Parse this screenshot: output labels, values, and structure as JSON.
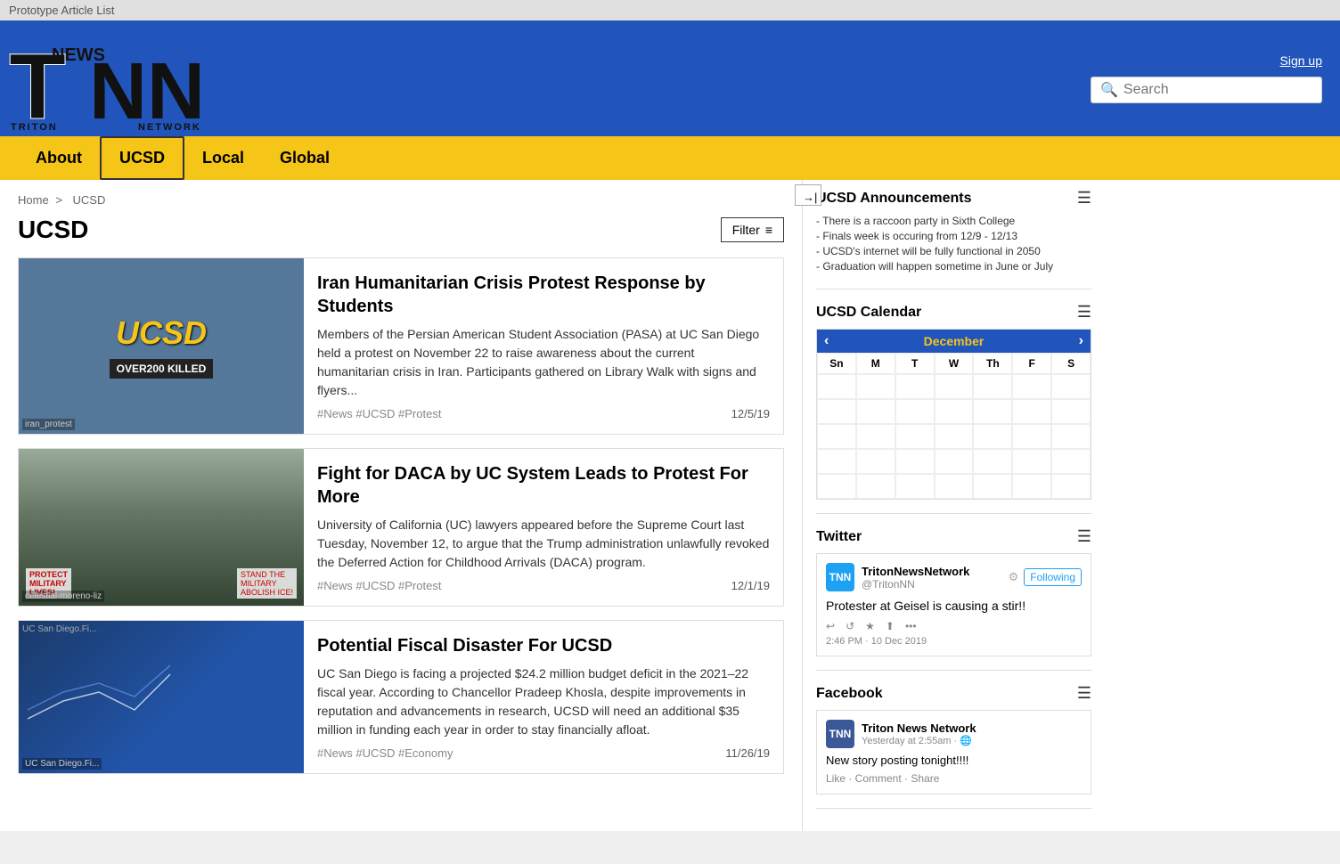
{
  "titleBar": {
    "text": "Prototype Article List"
  },
  "header": {
    "logoText": "TNN",
    "logoTriton": "TRITON",
    "logoNews": "NEWS",
    "logoNetwork": "NETWORK",
    "signupLabel": "Sign up",
    "searchPlaceholder": "Search"
  },
  "nav": {
    "items": [
      {
        "id": "about",
        "label": "About",
        "active": false
      },
      {
        "id": "ucsd",
        "label": "UCSD",
        "active": true
      },
      {
        "id": "local",
        "label": "Local",
        "active": false
      },
      {
        "id": "global",
        "label": "Global",
        "active": false
      }
    ]
  },
  "breadcrumb": {
    "home": "Home",
    "separator": ">",
    "current": "UCSD"
  },
  "pageTitle": "UCSD",
  "filterLabel": "Filter",
  "articles": [
    {
      "id": "article-1",
      "title": "Iran Humanitarian Crisis Protest Response by Students",
      "excerpt": "Members of the Persian American Student Association (PASA) at UC San Diego held a protest on November 22 to raise awareness about the current humanitarian crisis in Iran. Participants gathered on Library Walk with signs and flyers...",
      "tags": "#News #UCSD #Protest",
      "date": "12/5/19",
      "imageLabel": "iran_protest",
      "imageType": "ucsd-protest"
    },
    {
      "id": "article-2",
      "title": "Fight for DACA by UC System Leads to Protest For More",
      "excerpt": "University of California (UC) lawyers appeared before the Supreme Court last Tuesday, November 12, to argue that the Trump administration unlawfully revoked the Deferred Action for Childhood Arrivals (DACA) program.",
      "tags": "#News #UCSD #Protest",
      "date": "12/1/19",
      "imageLabel": "celestial-moreno-liz",
      "imageType": "daca-protest"
    },
    {
      "id": "article-3",
      "title": "Potential Fiscal Disaster For UCSD",
      "excerpt": "UC San Diego is facing a projected $24.2 million budget deficit in the 2021–22 fiscal year. According to Chancellor Pradeep Khosla, despite improvements in reputation and advancements in research, UCSD will need an additional $35 million in funding each year in order to stay financially afloat.",
      "tags": "#News #UCSD #Economy",
      "date": "11/26/19",
      "imageLabel": "UC San Diego.Fi...",
      "imageType": "fiscal"
    }
  ],
  "sidebar": {
    "collapseLabel": "→|",
    "announcements": {
      "title": "UCSD Announcements",
      "items": [
        "- There is a raccoon party in Sixth College",
        "- Finals week is occuring from 12/9 - 12/13",
        "- UCSD's internet will be fully functional in 2050",
        "- Graduation will happen sometime in June or July"
      ]
    },
    "calendar": {
      "title": "UCSD Calendar",
      "month": "December",
      "prevLabel": "‹",
      "nextLabel": "›",
      "dayLabels": [
        "Sn",
        "M",
        "T",
        "W",
        "Th",
        "F",
        "S"
      ],
      "weeks": [
        [
          "",
          "",
          "",
          "",
          "",
          "",
          ""
        ],
        [
          "",
          "",
          "",
          "",
          "",
          "",
          ""
        ],
        [
          "",
          "",
          "",
          "",
          "",
          "",
          ""
        ],
        [
          "",
          "",
          "",
          "",
          "",
          "",
          ""
        ],
        [
          "",
          "",
          "",
          "",
          "",
          "",
          ""
        ]
      ]
    },
    "twitter": {
      "title": "Twitter",
      "handle": "@TritonNN",
      "name": "TritonNewsNetwork",
      "avatarText": "TNN",
      "followingLabel": "Following",
      "post": "Protester at Geisel is causing a stir!!",
      "timestamp": "2:46 PM · 10 Dec 2019",
      "actions": [
        "↩",
        "↺",
        "★",
        "⬆",
        "•••"
      ]
    },
    "facebook": {
      "title": "Facebook",
      "name": "Triton News Network",
      "meta": "Yesterday at 2:55am · 🌐",
      "post": "New story posting tonight!!!!",
      "actions": "Like · Comment · Share",
      "avatarText": "TNN"
    }
  }
}
